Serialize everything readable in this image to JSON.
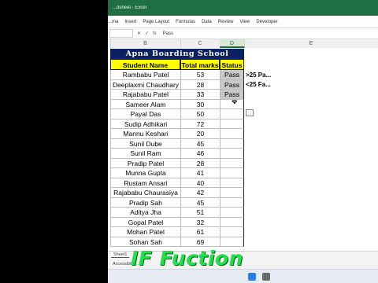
{
  "window": {
    "title": "...dsheet - Excel"
  },
  "ribbon": {
    "tabs": [
      "...ma",
      "Insert",
      "Page Layout",
      "Formulas",
      "Data",
      "Review",
      "View",
      "Developer"
    ]
  },
  "formula_bar": {
    "icons": [
      "✕",
      "✓",
      "fx"
    ],
    "value": "Pass"
  },
  "columns": [
    {
      "label": "B"
    },
    {
      "label": "C"
    },
    {
      "label": "D"
    },
    {
      "label": "E"
    }
  ],
  "table": {
    "title": "Apna Boarding School",
    "headers": {
      "name": "Student Name",
      "marks": "Total marks",
      "status": "Status"
    },
    "rows": [
      {
        "name": "Rambabu Patel",
        "marks": "53",
        "status": "Pass"
      },
      {
        "name": "Deeplaxmi Chaudhary",
        "marks": "28",
        "status": "Pass"
      },
      {
        "name": "Rajababu Patel",
        "marks": "33",
        "status": "Pass"
      },
      {
        "name": "Sameer Alam",
        "marks": "30",
        "status": ""
      },
      {
        "name": "Payal Das",
        "marks": "50",
        "status": ""
      },
      {
        "name": "Sudip Adhikari",
        "marks": "72",
        "status": ""
      },
      {
        "name": "Mannu Keshari",
        "marks": "20",
        "status": ""
      },
      {
        "name": "Sunil Dube",
        "marks": "45",
        "status": ""
      },
      {
        "name": "Sunil Ram",
        "marks": "46",
        "status": ""
      },
      {
        "name": "Pradip Patel",
        "marks": "28",
        "status": ""
      },
      {
        "name": "Munna Gupta",
        "marks": "41",
        "status": ""
      },
      {
        "name": "Rustam Ansari",
        "marks": "40",
        "status": ""
      },
      {
        "name": "Rajababu Chaurasiya",
        "marks": "42",
        "status": ""
      },
      {
        "name": "Pradip Sah",
        "marks": "45",
        "status": ""
      },
      {
        "name": "Aditya Jha",
        "marks": "51",
        "status": ""
      },
      {
        "name": "Gopal Patel",
        "marks": "32",
        "status": ""
      },
      {
        "name": "Mohan Patel",
        "marks": "61",
        "status": ""
      },
      {
        "name": "Sohan Sah",
        "marks": "69",
        "status": ""
      }
    ]
  },
  "side_notes": [
    ">25  Pa...",
    "<25  Fa..."
  ],
  "sheet_tabs": [
    {
      "label": "Sheet1"
    }
  ],
  "statusbar": {
    "accessibility": "Accessibility..."
  },
  "overlay": {
    "caption": "IF Fuction"
  },
  "colors": {
    "excel_green": "#1f6f43",
    "title_navy": "#0b1f63",
    "header_yellow": "#ffff00",
    "caption_green": "#1fe24a",
    "selection_gray": "#c8c8c8"
  }
}
